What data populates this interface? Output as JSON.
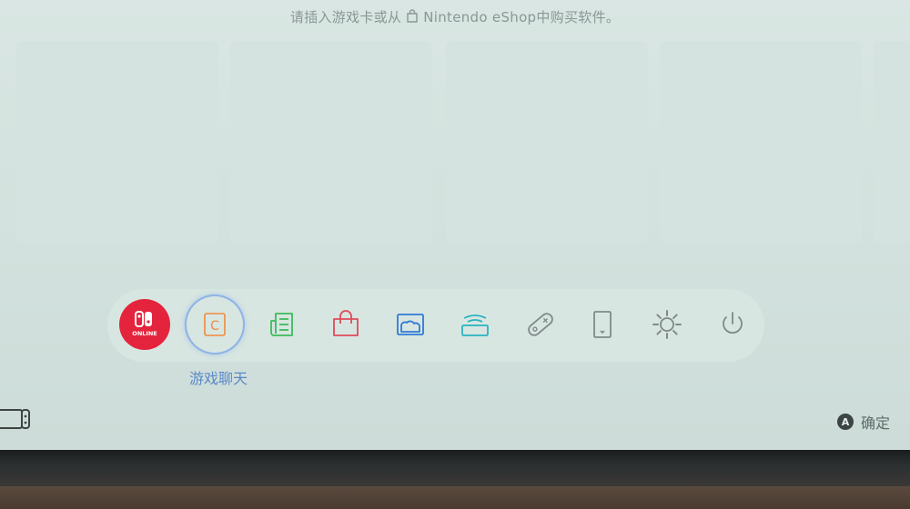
{
  "header": {
    "hint_before": "请插入游戏卡或从",
    "hint_after": "Nintendo eShop中购买软件。"
  },
  "dock": {
    "online_label": "ONLINE",
    "chat_letter": "C",
    "selected_label": "游戏聊天"
  },
  "footer": {
    "a_button": "A",
    "confirm_label": "确定"
  },
  "colors": {
    "online_red": "#e4243c",
    "chat_orange": "#f08a3c",
    "news_green": "#3dbb5a",
    "shop_red": "#e04b5a",
    "album_blue": "#2f7ad6",
    "controllers_teal": "#28b3c0",
    "gray_icon": "#7f8a88"
  },
  "icons": [
    "nintendo-switch-online-icon",
    "game-chat-icon",
    "news-icon",
    "eshop-icon",
    "album-icon",
    "controllers-icon",
    "joycon-icon",
    "virtual-console-icon",
    "settings-icon",
    "power-icon"
  ]
}
